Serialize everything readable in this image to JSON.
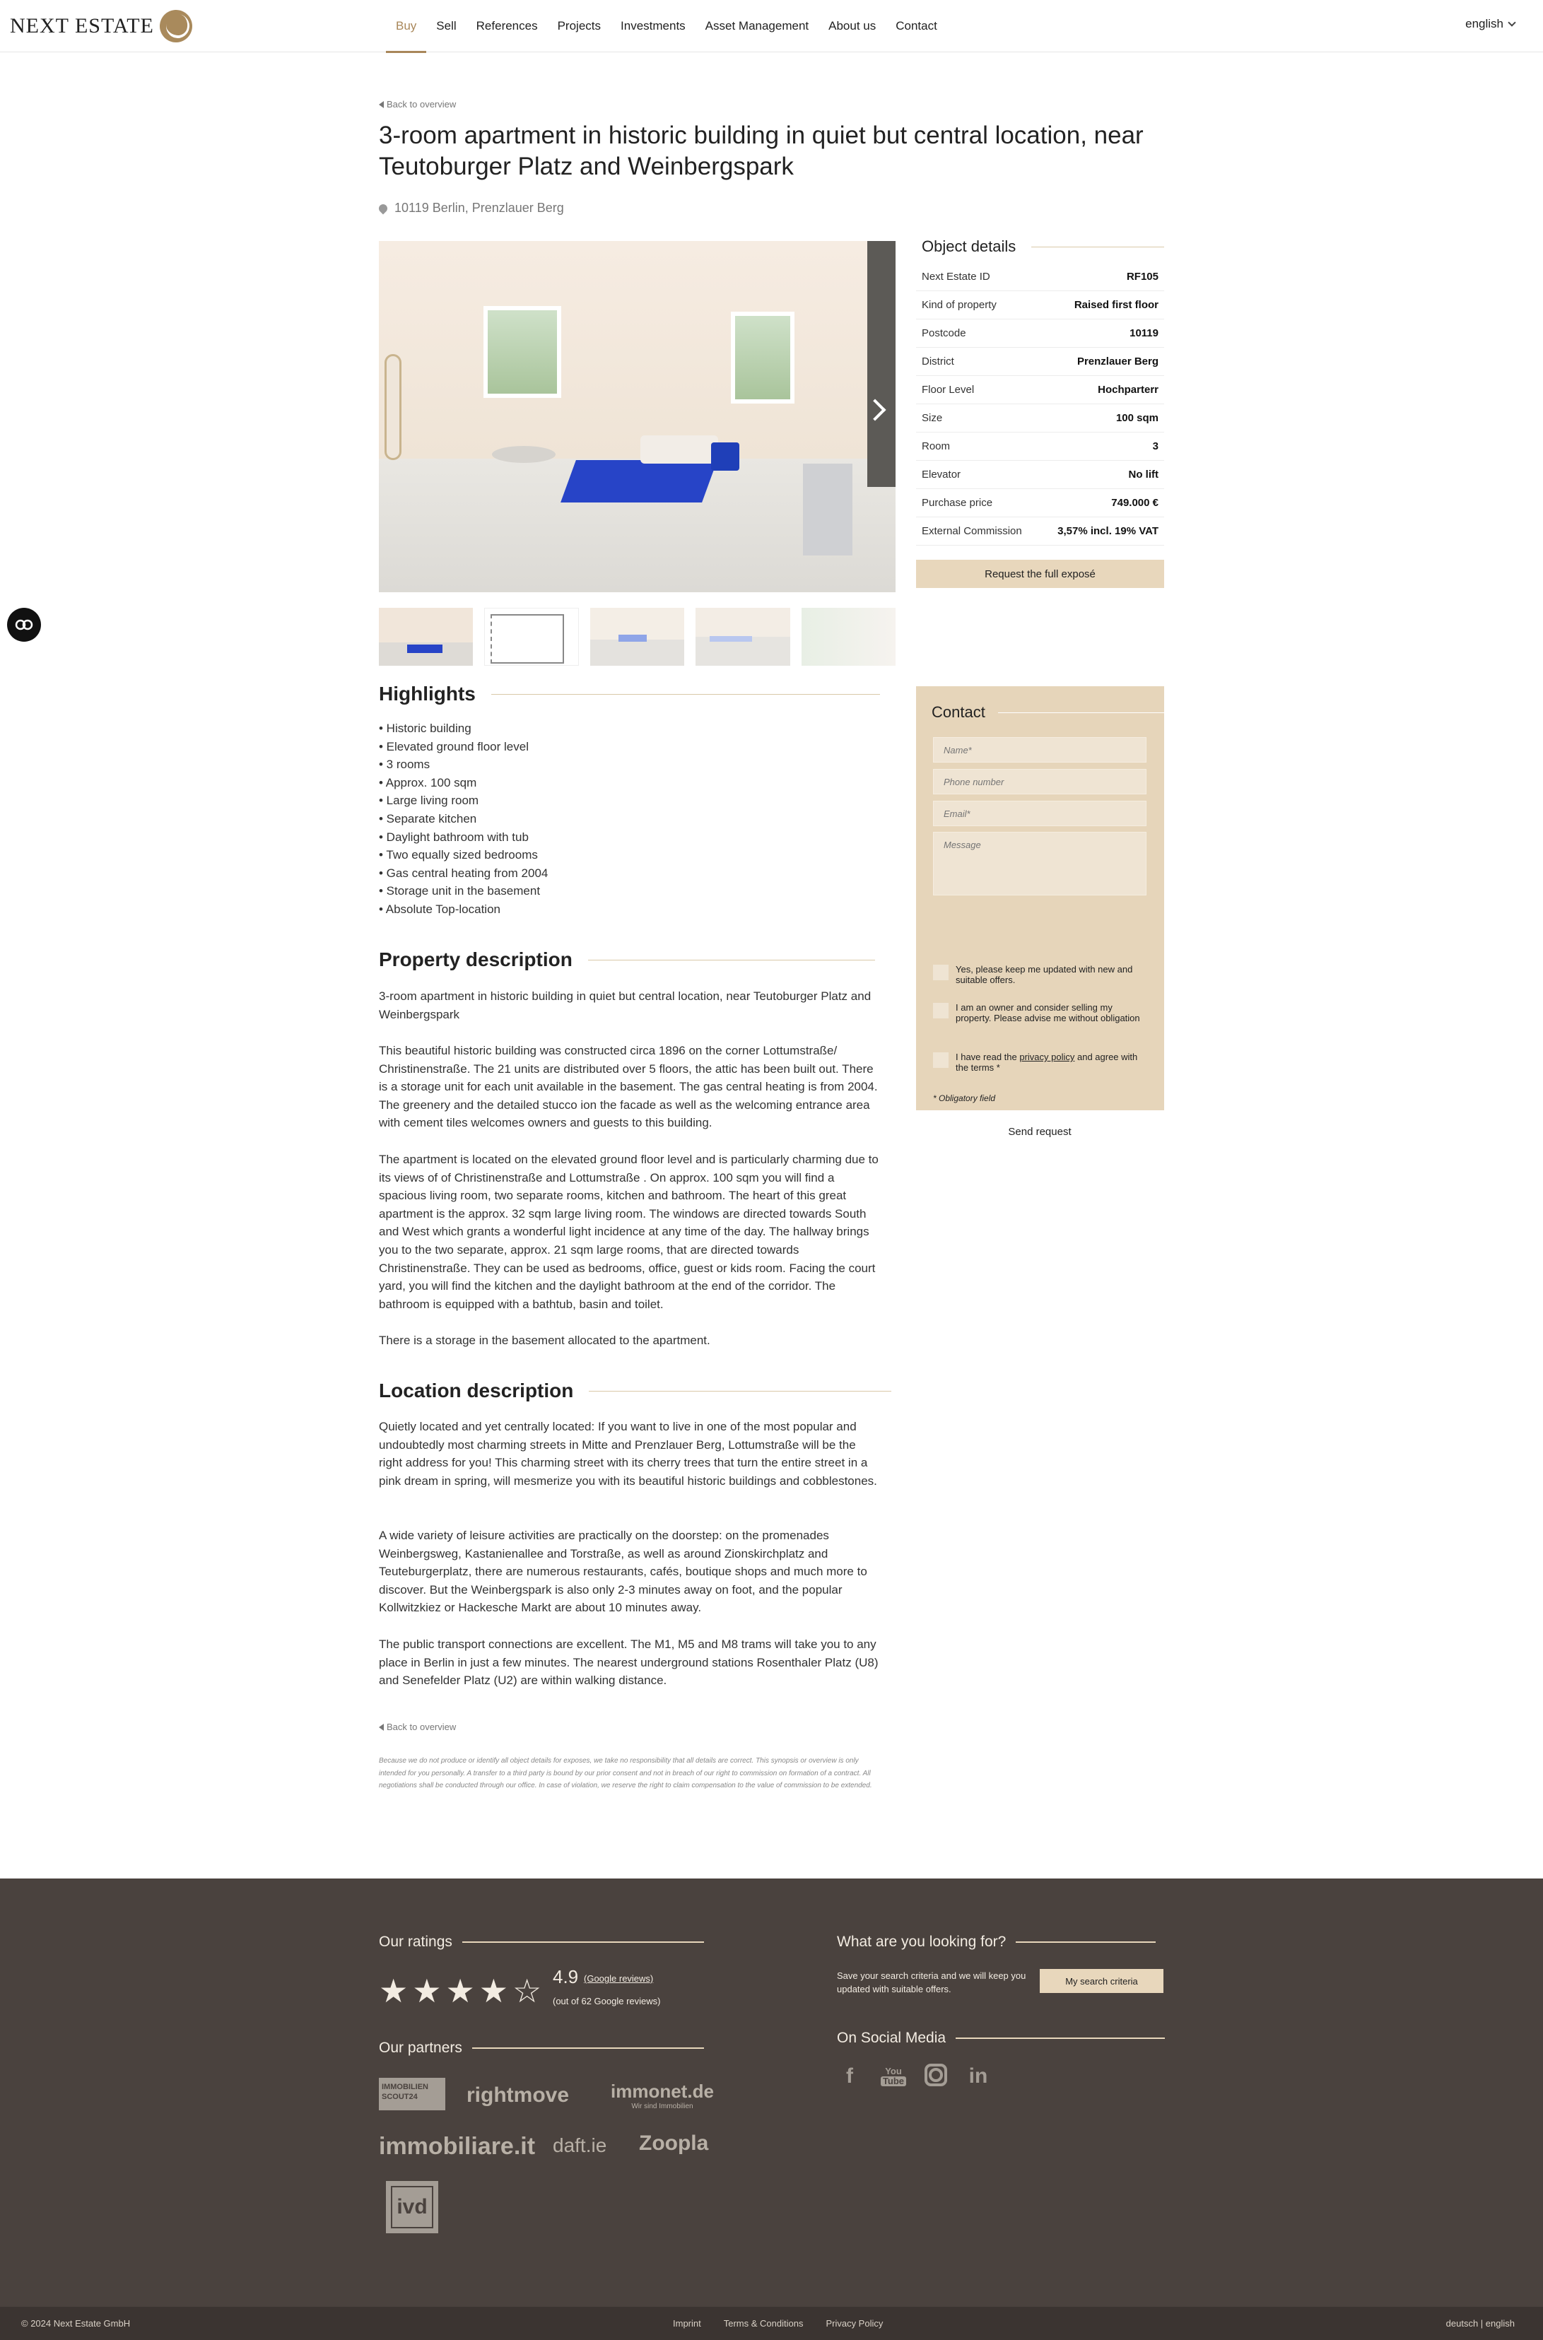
{
  "header": {
    "logo_text": "NEXT ESTATE",
    "nav": [
      "Buy",
      "Sell",
      "References",
      "Projects",
      "Investments",
      "Asset Management",
      "About us",
      "Contact"
    ],
    "active_nav": "Buy",
    "language": "english"
  },
  "listing": {
    "back_label": "Back to overview",
    "title": "3-room apartment in historic building in quiet but central location, near Teutoburger Platz and Weinbergspark",
    "address": "10119 Berlin, Prenzlauer Berg"
  },
  "object_details": {
    "title": "Object details",
    "rows": [
      {
        "label": "Next Estate ID",
        "value": "RF105"
      },
      {
        "label": "Kind of property",
        "value": "Raised first floor"
      },
      {
        "label": "Postcode",
        "value": "10119"
      },
      {
        "label": "District",
        "value": "Prenzlauer Berg"
      },
      {
        "label": "Floor Level",
        "value": "Hochparterr"
      },
      {
        "label": "Size",
        "value": "100 sqm"
      },
      {
        "label": "Room",
        "value": "3"
      },
      {
        "label": "Elevator",
        "value": "No lift"
      },
      {
        "label": "Purchase price",
        "value": "749.000 €"
      },
      {
        "label": "External Commission",
        "value": "3,57% incl. 19% VAT"
      }
    ],
    "expose_button": "Request the full exposé"
  },
  "highlights": {
    "title": "Highlights",
    "items": [
      "• Historic building",
      "• Elevated ground floor level",
      "• 3 rooms",
      "• Approx. 100 sqm",
      "• Large living room",
      "• Separate kitchen",
      "• Daylight bathroom with tub",
      "• Two equally sized bedrooms",
      "• Gas central heating from 2004",
      "• Storage unit in the basement",
      "• Absolute Top-location"
    ]
  },
  "property_description": {
    "title": "Property description",
    "paragraphs": [
      "3-room apartment in historic building in quiet but central location, near Teutoburger Platz and Weinbergspark",
      "This beautiful historic building was constructed circa 1896 on the corner Lottumstraße/ Christinenstraße. The 21 units are distributed over 5 floors, the attic has been built out. There is a storage unit for each unit available in the basement. The gas central heating is from 2004. The greenery and the detailed stucco ion the facade as well as the welcoming entrance area with cement tiles welcomes owners and guests to this building.",
      "The apartment is located on the elevated ground floor level and is particularly charming due to its views of of Christinenstraße and Lottumstraße . On approx. 100 sqm you will find a spacious living room, two separate rooms, kitchen and bathroom. The heart of this great apartment is the approx. 32 sqm large living room. The windows are directed towards South and West which grants a wonderful light incidence at any time of the day. The hallway brings you to the two separate, approx. 21 sqm large rooms, that are directed towards Christinenstraße. They can be used as bedrooms, office, guest or kids room. Facing the court yard, you will find the kitchen and the daylight bathroom at the end of the corridor. The bathroom is equipped with a bathtub, basin and toilet.",
      "There is a storage in the basement allocated to the apartment."
    ]
  },
  "location_description": {
    "title": "Location description",
    "paragraphs": [
      "Quietly located and yet centrally located: If you want to live in one of the most popular and undoubtedly most charming streets in Mitte and Prenzlauer Berg, Lottumstraße will be the right address for you! This charming street with its cherry trees that turn the entire street in a pink dream in spring, will mesmerize you with its beautiful historic buildings and cobblestones.",
      "A wide variety of leisure activities are practically on the doorstep: on the promenades Weinbergsweg, Kastanienallee and Torstraße, as well as around Zionskirchplatz and Teuteburgerplatz, there are numerous restaurants, cafés, boutique shops and much more to discover. But the Weinbergspark is also only 2-3 minutes away on foot, and the popular Kollwitzkiez or Hackesche Markt are about 10 minutes away.",
      "The public transport connections are excellent. The M1, M5 and M8 trams will take you to any place in Berlin in just a few minutes. The nearest underground stations Rosenthaler Platz (U8) and Senefelder Platz (U2) are within walking distance."
    ]
  },
  "disclaimer": "Because we do not produce or identify all object details for exposes, we take no responsibility that all details are correct. This synopsis or overview is only intended for you personally. A transfer to a third party is bound by our prior consent and not in breach of our right to commission on formation of a contract. All negotiations shall be conducted through our office. In case of violation, we reserve the right to claim compensation to the value of commission to be extended.",
  "contact": {
    "title": "Contact",
    "name_placeholder": "Name*",
    "phone_placeholder": "Phone number",
    "email_placeholder": "Email*",
    "message_placeholder": "Message",
    "cb_updates": "Yes, please keep me updated with new and suitable offers.",
    "cb_owner": "I am an owner and consider selling my property. Please advise me without obligation",
    "cb_privacy_pre": "I have read the ",
    "cb_privacy_link": "privacy policy",
    "cb_privacy_post": " and agree with the terms *",
    "obligatory": "* Obligatory field",
    "send_button": "Send request"
  },
  "footer": {
    "ratings_title": "Our ratings",
    "rating_value": "4.9",
    "rating_source": "(Google reviews)",
    "rating_count": "(out of 62 Google reviews)",
    "partners_title": "Our partners",
    "partners": {
      "scout": "IMMOBILIEN SCOUT24",
      "rightmove": "rightmove",
      "immonet": "immonet.de",
      "immonet_tag": "Wir sind Immobilien",
      "immobiliare": "immobiliare.it",
      "daft": "daft.ie",
      "zoopla": "Zoopla",
      "ivd": "ivd"
    },
    "looking_title": "What are you looking for?",
    "looking_text": "Save your search criteria and we will keep you updated with suitable offers.",
    "search_button": "My search criteria",
    "social_title": "On Social Media",
    "copyright": "© 2024 Next Estate GmbH",
    "legal": [
      "Imprint",
      "Terms & Conditions",
      "Privacy Policy"
    ],
    "languages": "deutsch  |  english"
  },
  "colors": {
    "accent": "#a9875a",
    "beige": "#e8d7bc",
    "footer_bg": "#4a423e",
    "sofa_blue": "#2744c7"
  }
}
